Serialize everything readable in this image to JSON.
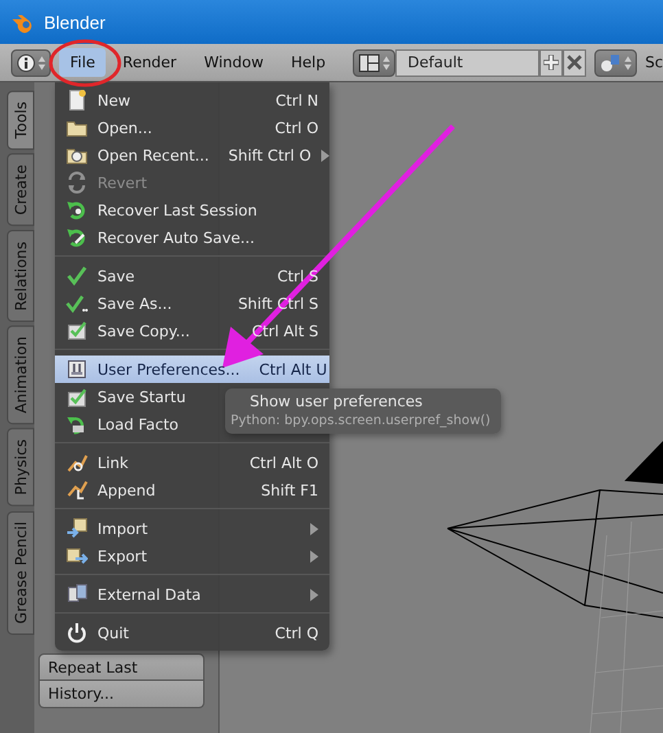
{
  "window": {
    "title": "Blender"
  },
  "header": {
    "menus": [
      {
        "label": "File",
        "selected": true
      },
      {
        "label": "Render",
        "selected": false
      },
      {
        "label": "Window",
        "selected": false
      },
      {
        "label": "Help",
        "selected": false
      }
    ],
    "layout": "Default",
    "scene": "Sc"
  },
  "shelf": {
    "tabs": [
      {
        "label": "Tools",
        "selected": true
      },
      {
        "label": "Create",
        "selected": false
      },
      {
        "label": "Relations",
        "selected": false
      },
      {
        "label": "Animation",
        "selected": false
      },
      {
        "label": "Physics",
        "selected": false
      },
      {
        "label": "Grease Pencil",
        "selected": false
      }
    ],
    "buttons": [
      "Repeat Last",
      "History..."
    ]
  },
  "file_menu": {
    "groups": [
      [
        {
          "label": "New",
          "shortcut": "Ctrl N",
          "disabled": false,
          "selected": false,
          "submenu": false
        },
        {
          "label": "Open...",
          "shortcut": "Ctrl O",
          "disabled": false,
          "selected": false,
          "submenu": false
        },
        {
          "label": "Open Recent...",
          "shortcut": "Shift Ctrl O",
          "disabled": false,
          "selected": false,
          "submenu": true
        },
        {
          "label": "Revert",
          "disabled": true,
          "selected": false,
          "submenu": false
        },
        {
          "label": "Recover Last Session",
          "disabled": false,
          "selected": false,
          "submenu": false
        },
        {
          "label": "Recover Auto Save...",
          "disabled": false,
          "selected": false,
          "submenu": false
        }
      ],
      [
        {
          "label": "Save",
          "shortcut": "Ctrl S",
          "disabled": false,
          "selected": false,
          "submenu": false
        },
        {
          "label": "Save As...",
          "shortcut": "Shift Ctrl S",
          "disabled": false,
          "selected": false,
          "submenu": false
        },
        {
          "label": "Save Copy...",
          "shortcut": "Ctrl Alt S",
          "disabled": false,
          "selected": false,
          "submenu": false
        }
      ],
      [
        {
          "label": "User Preferences...",
          "shortcut": "Ctrl Alt U",
          "disabled": false,
          "selected": true,
          "submenu": false
        },
        {
          "label": "Save Startu",
          "disabled": false,
          "selected": false,
          "submenu": false
        },
        {
          "label": "Load Facto",
          "disabled": false,
          "selected": false,
          "submenu": false
        }
      ],
      [
        {
          "label": "Link",
          "shortcut": "Ctrl Alt O",
          "disabled": false,
          "selected": false,
          "submenu": false
        },
        {
          "label": "Append",
          "shortcut": "Shift F1",
          "disabled": false,
          "selected": false,
          "submenu": false
        }
      ],
      [
        {
          "label": "Import",
          "disabled": false,
          "selected": false,
          "submenu": true
        },
        {
          "label": "Export",
          "disabled": false,
          "selected": false,
          "submenu": true
        }
      ],
      [
        {
          "label": "External Data",
          "disabled": false,
          "selected": false,
          "submenu": true
        }
      ],
      [
        {
          "label": "Quit",
          "shortcut": "Ctrl Q",
          "disabled": false,
          "selected": false,
          "submenu": false
        }
      ]
    ]
  },
  "tooltip": {
    "text": "Show user preferences",
    "python": "Python: bpy.ops.screen.userpref_show()"
  }
}
